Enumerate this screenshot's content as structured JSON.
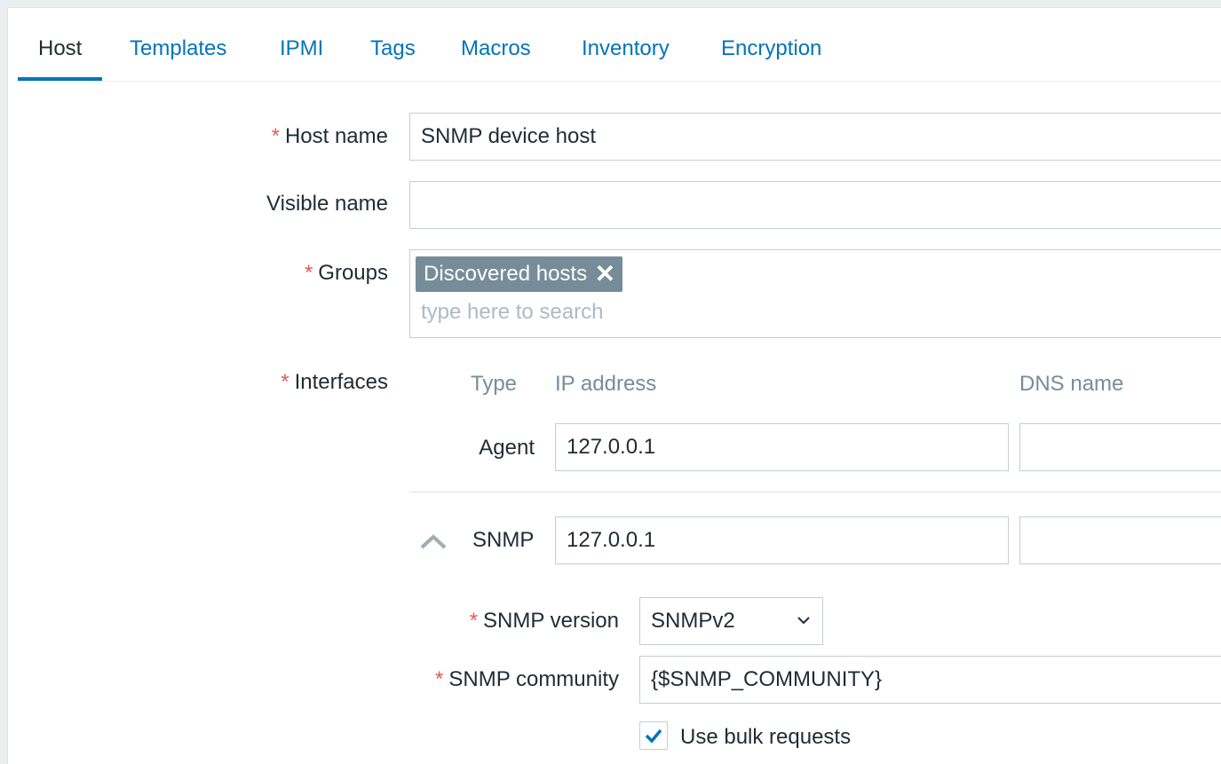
{
  "tabs": [
    {
      "label": "Host",
      "active": true
    },
    {
      "label": "Templates"
    },
    {
      "label": "IPMI"
    },
    {
      "label": "Tags"
    },
    {
      "label": "Macros"
    },
    {
      "label": "Inventory"
    },
    {
      "label": "Encryption"
    }
  ],
  "form": {
    "host_name": {
      "label": "Host name",
      "required": true,
      "value": "SNMP device host"
    },
    "visible_name": {
      "label": "Visible name",
      "value": ""
    },
    "groups": {
      "label": "Groups",
      "required": true,
      "selected": [
        "Discovered hosts"
      ],
      "placeholder": "type here to search"
    },
    "interfaces": {
      "label": "Interfaces",
      "required": true,
      "columns": {
        "type": "Type",
        "ip": "IP address",
        "dns": "DNS name"
      },
      "rows": [
        {
          "type": "Agent",
          "ip": "127.0.0.1",
          "dns": ""
        },
        {
          "type": "SNMP",
          "ip": "127.0.0.1",
          "dns": "",
          "expanded": true
        }
      ],
      "snmp": {
        "version_label": "SNMP version",
        "version_value": "SNMPv2",
        "community_label": "SNMP community",
        "community_value": "{$SNMP_COMMUNITY}",
        "bulk_label": "Use bulk requests",
        "bulk_checked": true
      }
    }
  },
  "colors": {
    "accent": "#0275b8",
    "required": "#e45959",
    "chip": "#768d99",
    "muted": "#768d99"
  },
  "icons": {
    "remove": "close-icon",
    "collapse": "chevron-up-icon",
    "dropdown": "chevron-down-icon",
    "check": "checkmark-icon"
  }
}
